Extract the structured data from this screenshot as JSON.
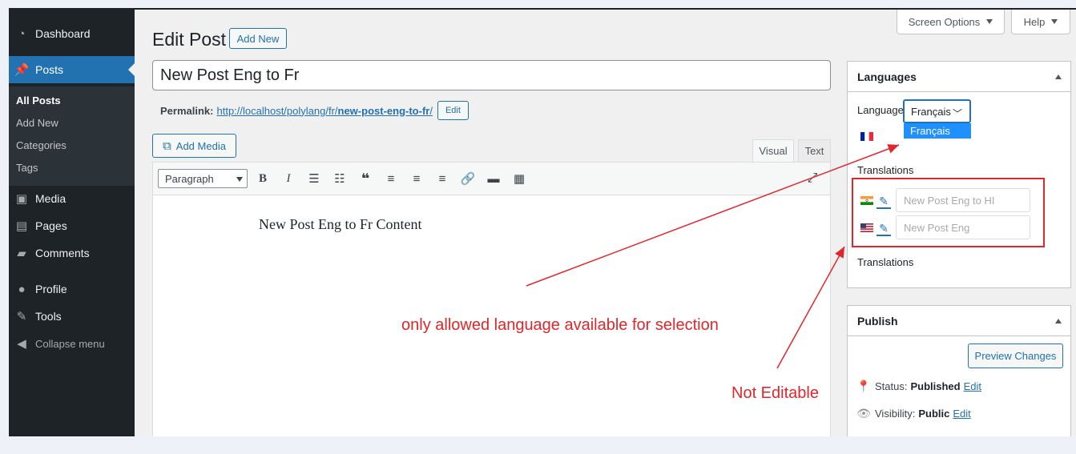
{
  "sidebar": {
    "items": [
      {
        "label": "Dashboard",
        "icon": "dashboard-icon"
      },
      {
        "label": "Posts",
        "icon": "pin-icon"
      },
      {
        "label": "Media",
        "icon": "media-icon"
      },
      {
        "label": "Pages",
        "icon": "pages-icon"
      },
      {
        "label": "Comments",
        "icon": "comments-icon"
      },
      {
        "label": "Profile",
        "icon": "user-icon"
      },
      {
        "label": "Tools",
        "icon": "wrench-icon"
      },
      {
        "label": "Collapse menu",
        "icon": "collapse-icon"
      }
    ],
    "submenu": [
      "All Posts",
      "Add New",
      "Categories",
      "Tags"
    ]
  },
  "header": {
    "title": "Edit Post",
    "add_new": "Add New",
    "screen_options": "Screen Options",
    "help": "Help"
  },
  "post": {
    "title": "New Post Eng to Fr",
    "permalink_label": "Permalink:",
    "permalink_base": "http://localhost/polylang/fr/",
    "permalink_slug": "new-post-eng-to-fr",
    "permalink_end": "/",
    "edit_label": "Edit",
    "content": "New Post Eng to Fr Content"
  },
  "editor": {
    "add_media": "Add Media",
    "tab_visual": "Visual",
    "tab_text": "Text",
    "format": "Paragraph"
  },
  "languages_box": {
    "title": "Languages",
    "language_label": "Language",
    "selected": "Français",
    "option": "Français",
    "translations_label": "Translations",
    "translations": [
      {
        "flag": "in-flag",
        "placeholder": "New Post Eng to HI"
      },
      {
        "flag": "us-flag",
        "placeholder": "New Post Eng"
      }
    ],
    "translations_label_2": "Translations"
  },
  "publish_box": {
    "title": "Publish",
    "preview": "Preview Changes",
    "status_label": "Status:",
    "status_value": "Published",
    "visibility_label": "Visibility:",
    "visibility_value": "Public",
    "edit": "Edit"
  },
  "annotations": {
    "language_note": "only allowed language available for selection",
    "edit_note": "Not Editable"
  },
  "colors": {
    "sidebar": "#1d2327",
    "accent": "#2271b1",
    "annotation": "#e0262a"
  }
}
